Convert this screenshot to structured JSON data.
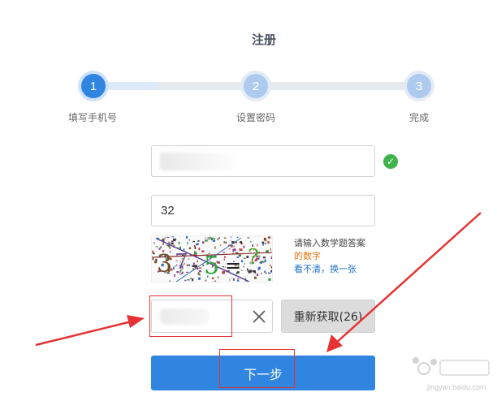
{
  "page": {
    "title": "注册"
  },
  "steps": [
    {
      "number": "1",
      "label": "填写手机号",
      "state": "active"
    },
    {
      "number": "2",
      "label": "设置密码",
      "state": "pending"
    },
    {
      "number": "3",
      "label": "完成",
      "state": "pending"
    }
  ],
  "form": {
    "phone_status": "valid",
    "answer_value": "32",
    "captcha_hint_line1": "请输入数学题答案",
    "captcha_hint_line2": "的数字",
    "captcha_refresh_link": "看不清，换一张",
    "resend_label": "重新获取(26)",
    "next_label": "下一步"
  },
  "captcha": {
    "glyphs": [
      "3",
      "7",
      "-",
      "5",
      "=",
      "?"
    ]
  },
  "watermark": {
    "text": "jingyan.baidu.com"
  },
  "colors": {
    "primary": "#2f85e0",
    "success": "#3fb24a",
    "annotation": "#e53333",
    "hint_orange": "#e9730b"
  }
}
